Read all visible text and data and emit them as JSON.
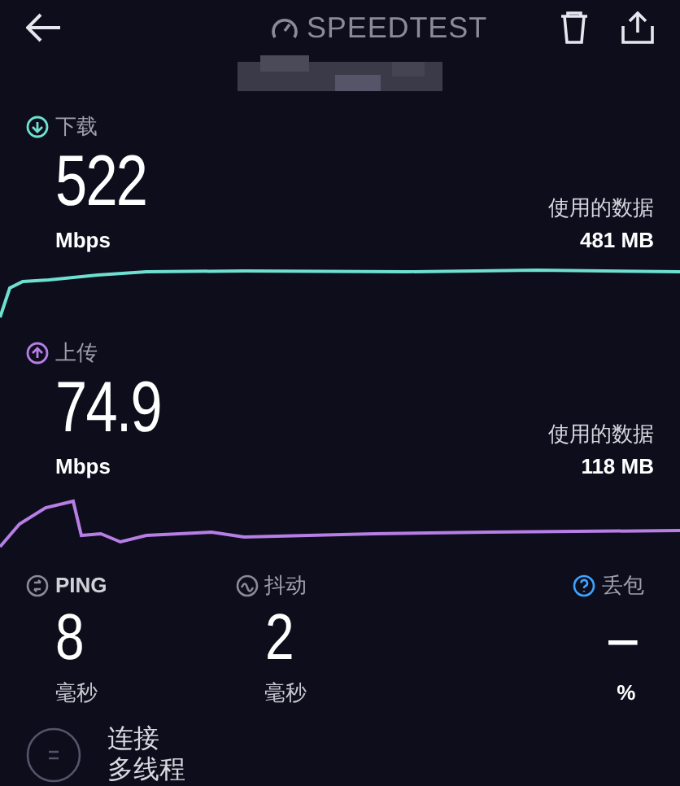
{
  "header": {
    "title": "SPEEDTEST"
  },
  "results": [
    {
      "kind": "download",
      "label": "下载",
      "value": "522",
      "unit": "Mbps",
      "data_label": "使用的数据",
      "data_value": "481 MB",
      "color": "#6ee0d0"
    },
    {
      "kind": "upload",
      "label": "上传",
      "value": "74.9",
      "unit": "Mbps",
      "data_label": "使用的数据",
      "data_value": "118 MB",
      "color": "#b77ee6"
    }
  ],
  "metrics": [
    {
      "kind": "ping",
      "label": "PING",
      "value": "8",
      "unit": "毫秒"
    },
    {
      "kind": "jitter",
      "label": "抖动",
      "value": "2",
      "unit": "毫秒"
    },
    {
      "kind": "loss",
      "label": "丢包",
      "value": "–",
      "unit": "%"
    }
  ],
  "connection": {
    "label": "连接",
    "value": "多线程"
  }
}
